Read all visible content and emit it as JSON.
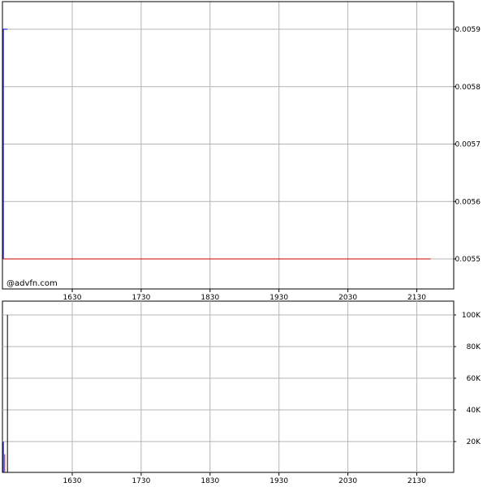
{
  "watermark": "@advfn.com",
  "chart_data": [
    {
      "type": "line",
      "name": "price",
      "x_ticks": [
        "1630",
        "1730",
        "1830",
        "1930",
        "2030",
        "2130"
      ],
      "y_ticks": [
        "0.0055",
        "0.0056",
        "0.0057",
        "0.0058",
        "0.0059"
      ],
      "ylim": [
        0.00546,
        0.00592
      ],
      "grid": true,
      "series": [
        {
          "color": "#0000cc",
          "points": [
            [
              1530,
              0.0055
            ],
            [
              1530,
              0.0059
            ],
            [
              1536,
              0.0059
            ]
          ]
        },
        {
          "color": "#cc0000",
          "points": [
            [
              1530,
              0.0055
            ],
            [
              2150,
              0.0055
            ]
          ]
        }
      ]
    },
    {
      "type": "bar",
      "name": "volume",
      "x_ticks": [
        "1630",
        "1730",
        "1830",
        "1930",
        "2030",
        "2130"
      ],
      "y_ticks": [
        "20K",
        "40K",
        "60K",
        "80K",
        "100K"
      ],
      "ylim": [
        0,
        105000
      ],
      "grid": true,
      "bars": [
        {
          "x": 1530,
          "value": 20000,
          "color": "#0000cc"
        },
        {
          "x": 1532,
          "value": 12000,
          "color": "#cc0000"
        },
        {
          "x": 1536,
          "value": 100000,
          "color": "#000000"
        }
      ]
    }
  ]
}
